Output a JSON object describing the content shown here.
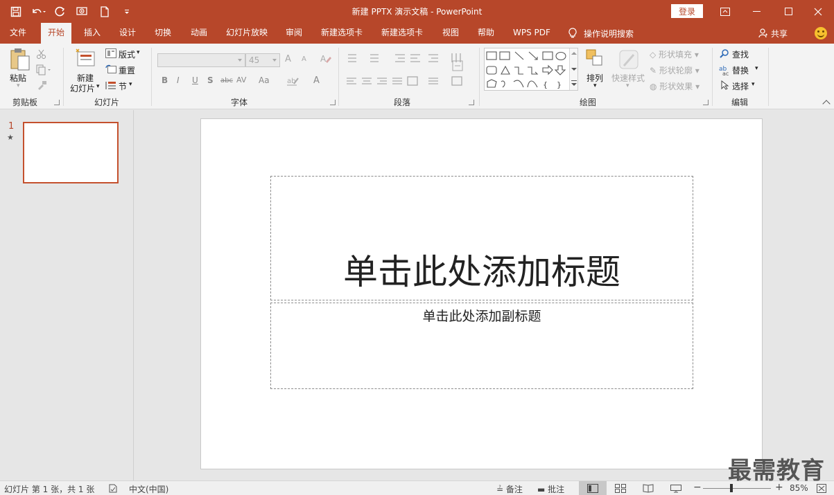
{
  "window": {
    "title": "新建 PPTX 演示文稿 - PowerPoint",
    "login_label": "登录",
    "controls": [
      "ribbon-display-icon",
      "minimize-icon",
      "maximize-icon",
      "close-icon"
    ]
  },
  "qat": {
    "icons": [
      "save-icon",
      "undo-icon",
      "redo-icon",
      "start-slideshow-icon",
      "new-file-icon",
      "customize-qat-icon"
    ]
  },
  "tabs": [
    "文件",
    "开始",
    "插入",
    "设计",
    "切换",
    "动画",
    "幻灯片放映",
    "审阅",
    "新建选项卡",
    "新建选项卡",
    "视图",
    "帮助",
    "WPS PDF"
  ],
  "active_tab": "开始",
  "tell_me": "操作说明搜索",
  "share_label": "共享",
  "ribbon": {
    "clipboard": {
      "label": "剪贴板",
      "paste": "粘贴"
    },
    "slides": {
      "label": "幻灯片",
      "new_slide_1": "新建",
      "new_slide_2": "幻灯片",
      "layout": "版式",
      "reset": "重置",
      "section": "节"
    },
    "font": {
      "label": "字体",
      "size": "45",
      "bold": "B",
      "italic": "I",
      "underline": "U",
      "shadow": "S",
      "strike": "abc",
      "spacing": "AV",
      "case": "Aa",
      "grow": "A",
      "shrink": "A",
      "color": "A"
    },
    "paragraph": {
      "label": "段落"
    },
    "drawing": {
      "label": "绘图",
      "arrange": "排列",
      "quick_styles": "快速样式",
      "shape_fill": "形状填充",
      "shape_outline": "形状轮廓",
      "shape_effects": "形状效果"
    },
    "editing": {
      "label": "编辑",
      "find": "查找",
      "replace": "替换",
      "select": "选择"
    }
  },
  "thumbnails": {
    "number": "1",
    "star": "★"
  },
  "slide": {
    "title_placeholder": "单击此处添加标题",
    "subtitle_placeholder": "单击此处添加副标题"
  },
  "status": {
    "slide_info": "幻灯片 第 1 张，共 1 张",
    "language": "中文(中国)",
    "notes": "备注",
    "comments": "批注",
    "zoom": "85%",
    "zoom_minus": "−",
    "zoom_plus": "+"
  },
  "watermark": "最需教育",
  "colors": {
    "accent": "#b7472a",
    "ribbon_bg": "#f3f3f3",
    "canvas_bg": "#e6e6e6"
  }
}
